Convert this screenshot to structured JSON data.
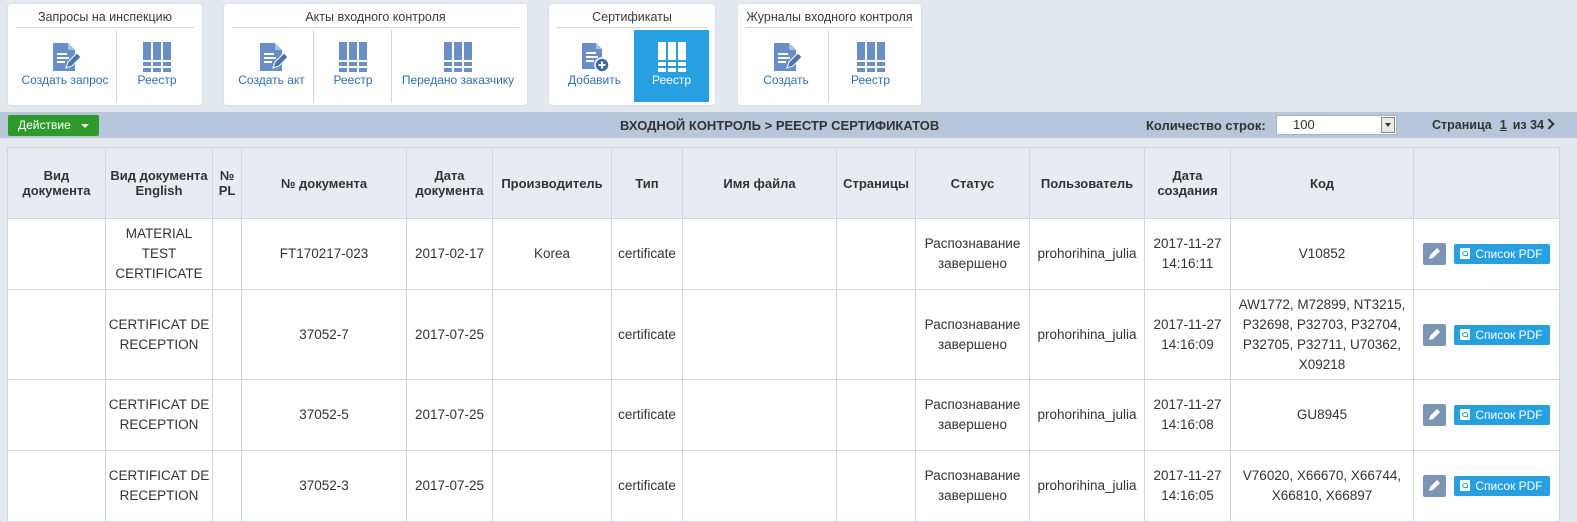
{
  "toolbar": {
    "groups": [
      {
        "title": "Запросы на инспекцию",
        "buttons": [
          {
            "label": "Создать запрос"
          },
          {
            "label": "Реестр"
          }
        ]
      },
      {
        "title": "Акты входного контроля",
        "buttons": [
          {
            "label": "Создать акт"
          },
          {
            "label": "Реестр"
          },
          {
            "label": "Передано заказчику"
          }
        ]
      },
      {
        "title": "Сертификаты",
        "buttons": [
          {
            "label": "Добавить"
          },
          {
            "label": "Реестр"
          }
        ]
      },
      {
        "title": "Журналы входного контроля",
        "buttons": [
          {
            "label": "Создать"
          },
          {
            "label": "Реестр"
          }
        ]
      }
    ],
    "active_button": "Сертификаты / Реестр"
  },
  "header_bar": {
    "action_label": "Действие",
    "title": "ВХОДНОЙ КОНТРОЛЬ > РЕЕСТР СЕРТИФИКАТОВ",
    "rows_label": "Количество строк:",
    "rows_value": "100",
    "page_label": "Страница",
    "page_current": "1",
    "page_total": "из 34"
  },
  "table": {
    "columns": [
      "Вид документа",
      "Вид документа English",
      "№ PL",
      "№ документа",
      "Дата документа",
      "Производитель",
      "Тип",
      "Имя файла",
      "Страницы",
      "Статус",
      "Пользователь",
      "Дата создания",
      "Код",
      ""
    ],
    "rows": [
      {
        "doc_type": "",
        "doc_type_en": "MATERIAL TEST CERTIFICATE",
        "pl": "",
        "doc_no": "FT170217-023",
        "doc_date": "2017-02-17",
        "maker": "Korea",
        "type": "certificate",
        "file": "",
        "pages": "",
        "status": "Распознавание завершено",
        "user": "prohorihina_julia",
        "created": "2017-11-27 14:16:11",
        "code": "V10852",
        "pdf_label": "Список PDF"
      },
      {
        "doc_type": "",
        "doc_type_en": "CERTIFICAT DE RECEPTION",
        "pl": "",
        "doc_no": "37052-7",
        "doc_date": "2017-07-25",
        "maker": "",
        "type": "certificate",
        "file": "",
        "pages": "",
        "status": "Распознавание завершено",
        "user": "prohorihina_julia",
        "created": "2017-11-27 14:16:09",
        "code": "AW1772, M72899, NT3215, P32698, P32703, P32704, P32705, P32711, U70362, X09218",
        "pdf_label": "Список PDF"
      },
      {
        "doc_type": "",
        "doc_type_en": "CERTIFICAT DE RECEPTION",
        "pl": "",
        "doc_no": "37052-5",
        "doc_date": "2017-07-25",
        "maker": "",
        "type": "certificate",
        "file": "",
        "pages": "",
        "status": "Распознавание завершено",
        "user": "prohorihina_julia",
        "created": "2017-11-27 14:16:08",
        "code": "GU8945",
        "pdf_label": "Список PDF"
      },
      {
        "doc_type": "",
        "doc_type_en": "CERTIFICAT DE RECEPTION",
        "pl": "",
        "doc_no": "37052-3",
        "doc_date": "2017-07-25",
        "maker": "",
        "type": "certificate",
        "file": "",
        "pages": "",
        "status": "Распознавание завершено",
        "user": "prohorihina_julia",
        "created": "2017-11-27 14:16:05",
        "code": "V76020, X66670, X66744, X66810, X66897",
        "pdf_label": "Список PDF"
      }
    ]
  },
  "colors": {
    "toolbar_bg": "#e4e8ef",
    "header_bar_bg": "#b7c6db",
    "active_button_bg": "#26a0e0",
    "action_button_bg": "#2f9a2c",
    "link_blue": "#2f6fb3",
    "edit_button_bg": "#7d95b4"
  },
  "icons": {
    "create": "document-pencil-icon",
    "registry": "registry-grid-icon",
    "add": "document-plus-icon",
    "edit": "pencil-icon",
    "pdf": "pdf-icon"
  }
}
